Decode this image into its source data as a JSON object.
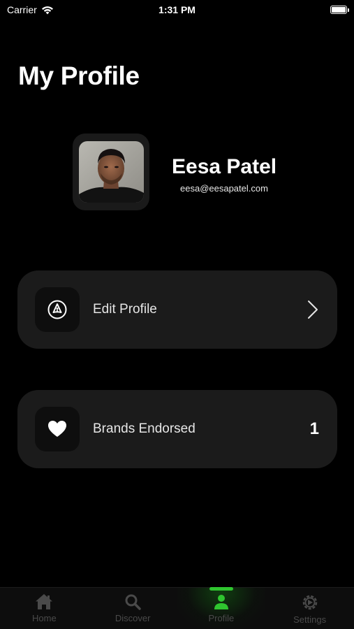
{
  "status_bar": {
    "carrier": "Carrier",
    "time": "1:31 PM"
  },
  "page": {
    "title": "My Profile"
  },
  "profile": {
    "name": "Eesa Patel",
    "email": "eesa@eesapatel.com"
  },
  "cards": {
    "edit_profile": {
      "label": "Edit Profile",
      "icon": "pen-nib-icon"
    },
    "brands_endorsed": {
      "label": "Brands Endorsed",
      "value": "1",
      "icon": "heart-icon"
    }
  },
  "tab_bar": {
    "active_tab": "Profile",
    "active_color": "#2fc52f",
    "tabs": [
      {
        "label": "Home",
        "icon": "home-icon"
      },
      {
        "label": "Discover",
        "icon": "search-icon"
      },
      {
        "label": "Profile",
        "icon": "person-icon"
      },
      {
        "label": "Settings",
        "icon": "gear-icon"
      }
    ]
  }
}
